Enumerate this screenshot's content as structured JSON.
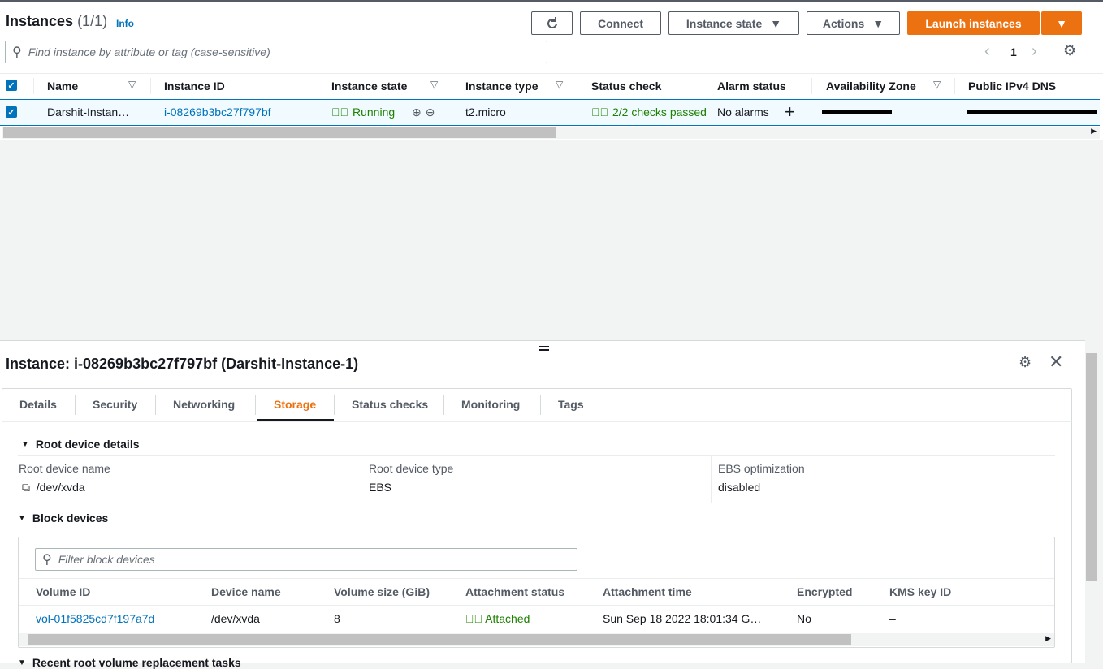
{
  "header": {
    "title": "Instances",
    "count": "(1/1)",
    "info": "Info"
  },
  "toolbar": {
    "refresh_icon": "refresh-icon",
    "connect": "Connect",
    "instance_state": "Instance state",
    "actions": "Actions",
    "launch": "Launch instances"
  },
  "search": {
    "placeholder": "Find instance by attribute or tag (case-sensitive)"
  },
  "pagination": {
    "page": "1"
  },
  "table": {
    "columns": [
      "Name",
      "Instance ID",
      "Instance state",
      "Instance type",
      "Status check",
      "Alarm status",
      "Availability Zone",
      "Public IPv4 DNS"
    ],
    "row": {
      "name": "Darshit-Instan…",
      "id": "i-08269b3bc27f797bf",
      "state": "Running",
      "type": "t2.micro",
      "status": "2/2 checks passed",
      "alarm": "No alarms"
    }
  },
  "detail": {
    "title": "Instance: i-08269b3bc27f797bf (Darshit-Instance-1)",
    "tabs": [
      "Details",
      "Security",
      "Networking",
      "Storage",
      "Status checks",
      "Monitoring",
      "Tags"
    ],
    "active_tab": "Storage",
    "root_section": "Root device details",
    "root_device_name_label": "Root device name",
    "root_device_name": "/dev/xvda",
    "root_device_type_label": "Root device type",
    "root_device_type": "EBS",
    "ebs_opt_label": "EBS optimization",
    "ebs_opt": "disabled",
    "block_section": "Block devices",
    "filter_placeholder": "Filter block devices",
    "block_columns": [
      "Volume ID",
      "Device name",
      "Volume size (GiB)",
      "Attachment status",
      "Attachment time",
      "Encrypted",
      "KMS key ID"
    ],
    "block_row": {
      "volume_id": "vol-01f5825cd7f197a7d",
      "device": "/dev/xvda",
      "size": "8",
      "status": "Attached",
      "time": "Sun Sep 18 2022 18:01:34 G…",
      "encrypted": "No",
      "kms": "–"
    },
    "next_section": "Recent root volume replacement tasks"
  },
  "colors": {
    "accent": "#ec7211",
    "link": "#0073bb",
    "success": "#1d8102"
  }
}
